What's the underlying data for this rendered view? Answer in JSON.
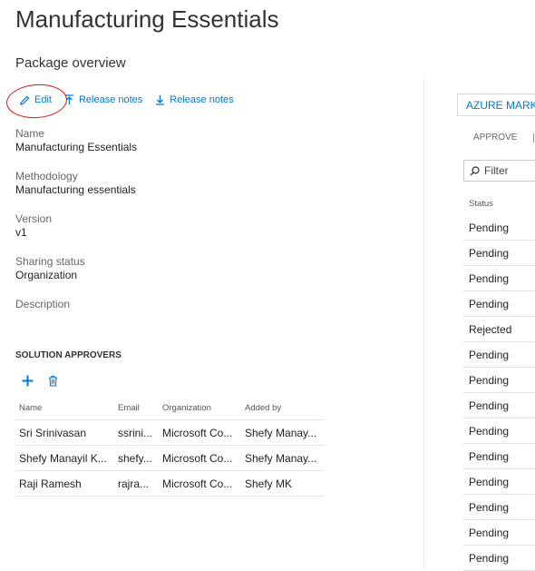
{
  "page": {
    "title": "Manufacturing Essentials",
    "subtitle": "Package overview"
  },
  "toolbar": {
    "edit_label": "Edit",
    "release_notes_upload_label": "Release notes",
    "release_notes_download_label": "Release notes"
  },
  "properties": {
    "name_label": "Name",
    "name_value": "Manufacturing Essentials",
    "methodology_label": "Methodology",
    "methodology_value": "Manufacturing essentials",
    "version_label": "Version",
    "version_value": "v1",
    "sharing_label": "Sharing status",
    "sharing_value": "Organization",
    "description_label": "Description"
  },
  "approvers": {
    "heading": "SOLUTION APPROVERS",
    "columns": [
      "Name",
      "Email",
      "Organization",
      "Added by"
    ],
    "rows": [
      [
        "Sri Srinivasan",
        "ssrini...",
        "Microsoft Co...",
        "Shefy Manay..."
      ],
      [
        "Shefy Manayil K...",
        "shefy...",
        "Microsoft Co...",
        "Shefy Manay..."
      ],
      [
        "Raji Ramesh",
        "rajra...",
        "Microsoft Co...",
        "Shefy MK"
      ]
    ]
  },
  "right_panel": {
    "tab_label": "AZURE MARK",
    "approve_label": "APPROVE",
    "filter_placeholder": "Filter",
    "status_header": "Status",
    "statuses": [
      "Pending",
      "Pending",
      "Pending",
      "Pending",
      "Rejected",
      "Pending",
      "Pending",
      "Pending",
      "Pending",
      "Pending",
      "Pending",
      "Pending",
      "Pending",
      "Pending"
    ]
  },
  "colors": {
    "accent": "#0078d4",
    "annotation": "#e01010"
  }
}
